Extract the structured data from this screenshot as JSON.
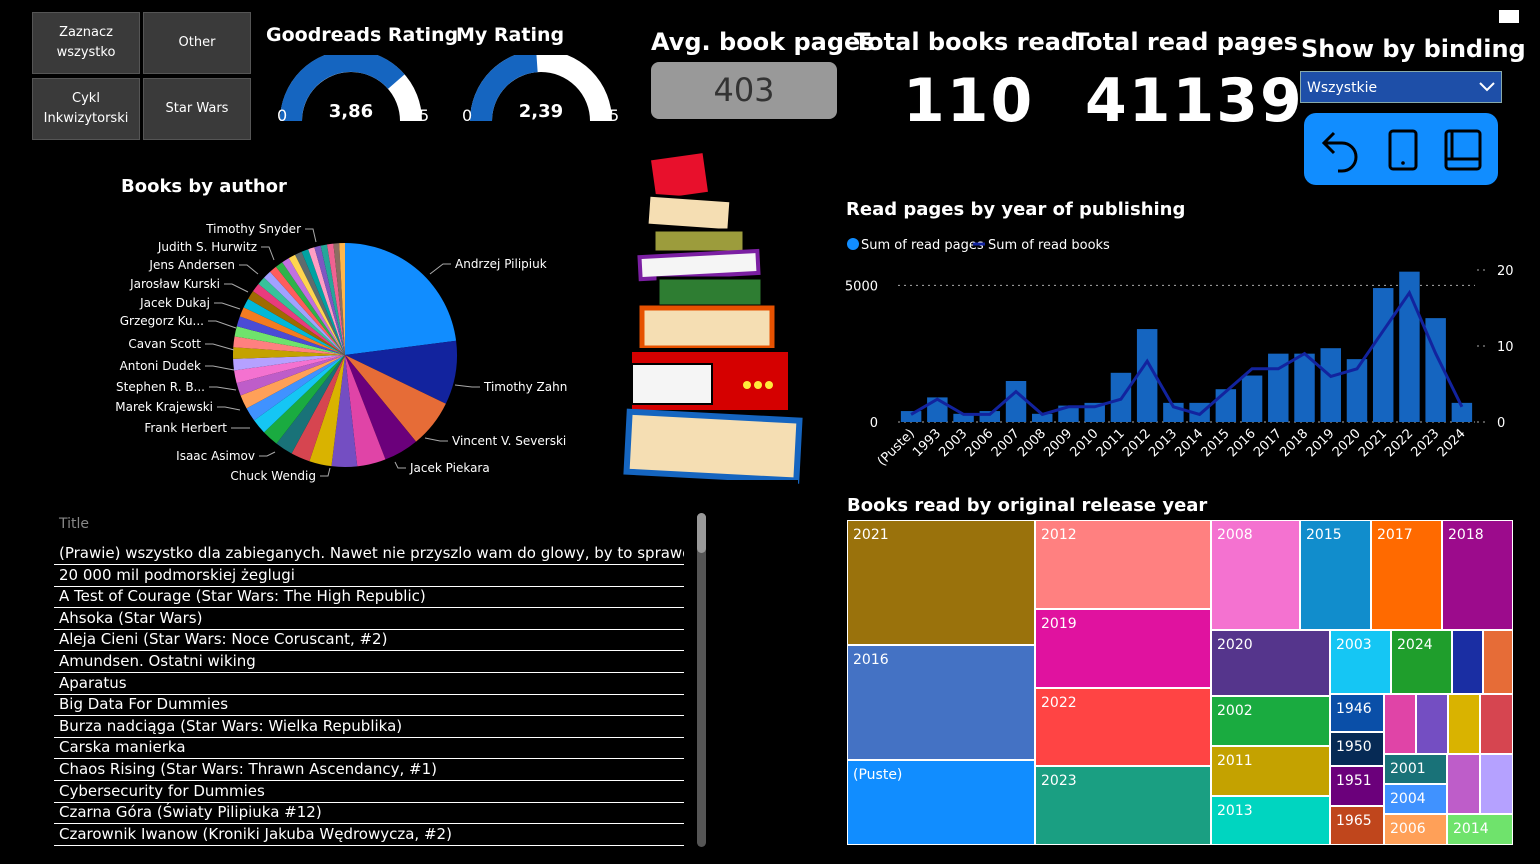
{
  "slicer_buttons": [
    "Zaznacz wszystko",
    "Other",
    "Cykl Inkwizytorski",
    "Star Wars"
  ],
  "gauges": [
    {
      "title": "Goodreads Rating",
      "min_label": "0",
      "max_label": "5",
      "value_label": "3,86",
      "value": 3.86,
      "max": 5
    },
    {
      "title": "My Rating",
      "min_label": "0",
      "max_label": "5",
      "value_label": "2,39",
      "value": 2.39,
      "max": 5
    }
  ],
  "kpis": {
    "avg_pages_title": "Avg. book pages",
    "avg_pages_value": "403",
    "total_books_title": "Total books read",
    "total_books_value": "110",
    "total_pages_title": "Total read pages",
    "total_pages_value": "41139"
  },
  "binding": {
    "title": "Show by binding",
    "selected": "Wszystkie"
  },
  "icons": [
    "back-arrow-icon",
    "tablet-icon",
    "ebook-reader-icon",
    "book-stack-illustration",
    "chevron-down-icon",
    "window-icon"
  ],
  "colors": {
    "accent": "#118dff",
    "line": "#12239e",
    "background": "#000000"
  },
  "pie": {
    "title": "Books by author",
    "labels": [
      {
        "text": "Andrzej Pilipiuk"
      },
      {
        "text": "Timothy Zahn"
      },
      {
        "text": "Vincent V. Severski"
      },
      {
        "text": "Jacek Piekara"
      },
      {
        "text": "Chuck Wendig"
      },
      {
        "text": "Isaac Asimov"
      },
      {
        "text": "Frank Herbert"
      },
      {
        "text": "Marek Krajewski"
      },
      {
        "text": "Stephen R. B..."
      },
      {
        "text": "Antoni Dudek"
      },
      {
        "text": "Cavan Scott"
      },
      {
        "text": "Grzegorz Ku..."
      },
      {
        "text": "Jacek Dukaj"
      },
      {
        "text": "Jarosław Kurski"
      },
      {
        "text": "Jens Andersen"
      },
      {
        "text": "Judith S. Hurwitz"
      },
      {
        "text": "Timothy Snyder"
      }
    ]
  },
  "chart_data": {
    "type": "bar",
    "title": "Read pages by year of publishing",
    "legend": [
      "Sum of read pages",
      "Sum of read books"
    ],
    "categories": [
      "(Puste)",
      "1993",
      "2003",
      "2006",
      "2007",
      "2008",
      "2009",
      "2010",
      "2011",
      "2012",
      "2013",
      "2014",
      "2015",
      "2016",
      "2017",
      "2018",
      "2019",
      "2020",
      "2021",
      "2022",
      "2023",
      "2024"
    ],
    "series": [
      {
        "name": "Sum of read pages",
        "type": "bar",
        "axis": "left",
        "values": [
          400,
          900,
          300,
          400,
          1500,
          300,
          600,
          700,
          1800,
          3400,
          700,
          700,
          1200,
          1700,
          2500,
          2500,
          2700,
          2300,
          4900,
          5500,
          3800,
          700
        ]
      },
      {
        "name": "Sum of read books",
        "type": "line",
        "axis": "right",
        "values": [
          1,
          3,
          1,
          1,
          4,
          1,
          2,
          2,
          3,
          8,
          2,
          1,
          4,
          7,
          7,
          9,
          6,
          7,
          12,
          17,
          9,
          2
        ]
      }
    ],
    "ylim_left": [
      0,
      6000
    ],
    "yticks_left": [
      0,
      5000
    ],
    "ylim_right": [
      0,
      20
    ],
    "yticks_right": [
      0,
      10,
      20
    ],
    "legend_position": "top-left"
  },
  "table": {
    "header": "Title",
    "rows": [
      "(Prawie) wszystko dla zabieganych. Nawet nie przyszlo wam do glowy, by to sprawdzic",
      "20 000 mil podmorskiej żeglugi",
      "A Test of Courage (Star Wars: The High Republic)",
      "Ahsoka (Star Wars)",
      "Aleja Cieni (Star Wars: Noce Coruscant, #2)",
      "Amundsen. Ostatni wiking",
      "Aparatus",
      "Big Data For Dummies",
      "Burza nadciąga (Star Wars: Wielka Republika)",
      "Carska manierka",
      "Chaos Rising (Star Wars: Thrawn Ascendancy, #1)",
      "Cybersecurity for Dummies",
      "Czarna Góra (Światy Pilipiuka #12)",
      "Czarownik Iwanow (Kroniki Jakuba Wędrowycza, #2)"
    ]
  },
  "treemap": {
    "title": "Books read by original release year",
    "labels": [
      "2021",
      "2016",
      "(Puste)",
      "2012",
      "2019",
      "2022",
      "2023",
      "2008",
      "2015",
      "2017",
      "2018",
      "2020",
      "2003",
      "2024",
      "2002",
      "2011",
      "2013",
      "1946",
      "1950",
      "1951",
      "1965",
      "2001",
      "2004",
      "2006",
      "2014"
    ]
  }
}
